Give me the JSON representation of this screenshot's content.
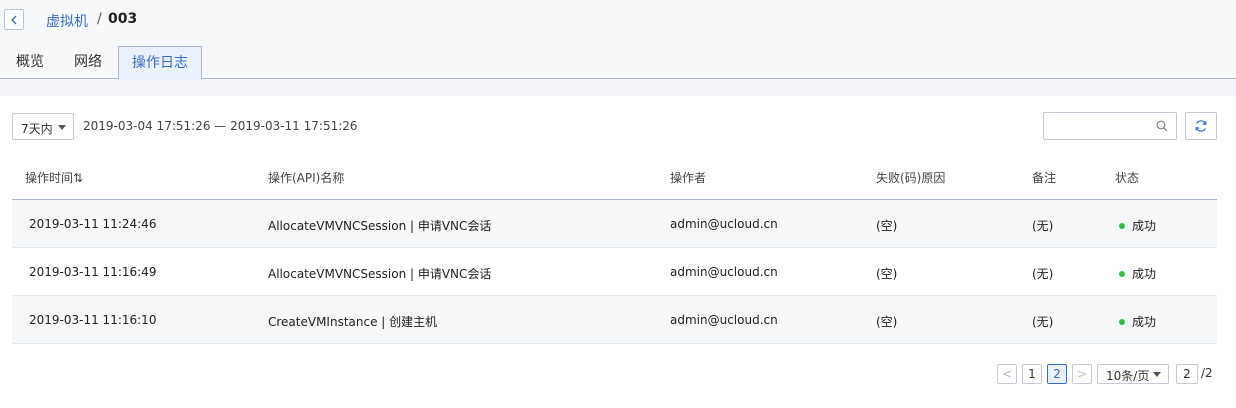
{
  "breadcrumb": {
    "parent": "虚拟机",
    "separator": "/",
    "current": "003"
  },
  "tabs": [
    {
      "label": "概览",
      "active": false
    },
    {
      "label": "网络",
      "active": false
    },
    {
      "label": "操作日志",
      "active": true
    }
  ],
  "filter": {
    "range_label": "7天内",
    "date_range": "2019-03-04 17:51:26 — 2019-03-11 17:51:26",
    "search_placeholder": ""
  },
  "table": {
    "columns": [
      "操作时间⇅",
      "操作(API)名称",
      "操作者",
      "失败(码)原因",
      "备注",
      "状态"
    ],
    "rows": [
      {
        "time": "2019-03-11 11:24:46",
        "api": "AllocateVMVNCSession | 申请VNC会话",
        "operator": "admin@ucloud.cn",
        "reason": "(空)",
        "note": "(无)",
        "status": "成功"
      },
      {
        "time": "2019-03-11 11:16:49",
        "api": "AllocateVMVNCSession | 申请VNC会话",
        "operator": "admin@ucloud.cn",
        "reason": "(空)",
        "note": "(无)",
        "status": "成功"
      },
      {
        "time": "2019-03-11 11:16:10",
        "api": "CreateVMInstance | 创建主机",
        "operator": "admin@ucloud.cn",
        "reason": "(空)",
        "note": "(无)",
        "status": "成功"
      }
    ]
  },
  "pagination": {
    "prev": "<",
    "pages": [
      "1",
      "2"
    ],
    "current_page": "2",
    "next": ">",
    "page_size": "10条/页",
    "jump_value": "2",
    "total": "/2"
  },
  "colors": {
    "accent": "#3b6cc4",
    "success": "#3cb94a"
  }
}
